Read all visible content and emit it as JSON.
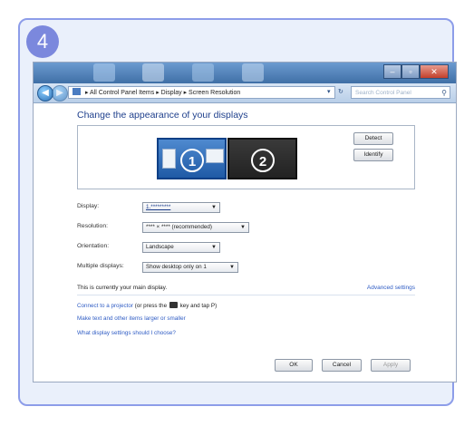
{
  "step": {
    "number": "4"
  },
  "window": {
    "address": {
      "items": [
        "All Control Panel Items",
        "Display",
        "Screen Resolution"
      ],
      "separator": "▸",
      "refresh_glyph": "↻",
      "search_placeholder": "Search Control Panel"
    },
    "heading": "Change the appearance of your displays",
    "monitors": {
      "m1": "1",
      "m2": "2"
    },
    "buttons": {
      "detect": "Detect",
      "identify": "Identify",
      "ok": "OK",
      "cancel": "Cancel",
      "apply": "Apply"
    },
    "fields": {
      "display": {
        "label": "Display:",
        "value": "1.*********"
      },
      "resolution": {
        "label": "Resolution:",
        "value": "**** × **** (recommended)"
      },
      "orientation": {
        "label": "Orientation:",
        "value": "Landscape"
      },
      "multiple": {
        "label": "Multiple displays:",
        "value": "Show desktop only on 1"
      }
    },
    "info": "This is currently your main display.",
    "advanced": "Advanced settings",
    "links": {
      "projector_prefix": "Connect to a projector",
      "projector_suffix": "(or press the",
      "projector_tail": "key and tap P)",
      "text_size": "Make text and other items larger or smaller",
      "which_settings": "What display settings should I choose?"
    }
  },
  "icons": [
    "back-arrow-icon",
    "forward-arrow-icon",
    "search-icon",
    "windows-key-icon",
    "dropdown-arrow-icon"
  ]
}
